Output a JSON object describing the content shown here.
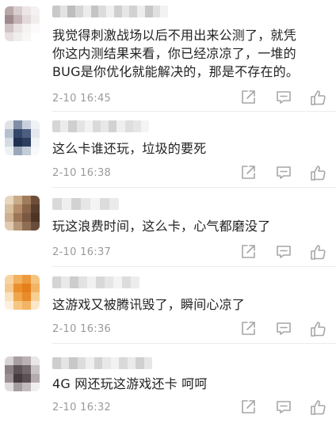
{
  "comments": [
    {
      "text_lines": [
        "我觉得刺激战场以后不用出来公测了，就凭",
        "你这内测结果来看，你已经凉凉了，一堆的",
        "BUG是你优化就能解决的，那是不存在的。"
      ],
      "time": "2-10 16:45",
      "avatar_colors": [
        "#b9a8a8",
        "#d8cdcd",
        "#ece6e6",
        "#f4f1f1",
        "#9e8a8c",
        "#c4b3b5",
        "#e2d9da",
        "#f1eded",
        "#d0c3c5",
        "#e9e1e2",
        "#f5f2f2",
        "#fbf9f9",
        "#e7dfe0",
        "#f2eded",
        "#f8f6f6",
        "#ffffff"
      ],
      "name_colors": [
        "#c9c9c9",
        "#e3e3e3",
        "#bdbdbd",
        "#d6d6d6",
        "#ececec",
        "#c4c4c4",
        "#dcdcdc",
        "#f0f0f0",
        "#cfcfcf",
        "#e6e6e6",
        "#d2d2d2",
        "#eeeeee",
        "#c7c7c7",
        "#e0e0e0",
        "#f2f2f2"
      ]
    },
    {
      "text_lines": [
        "这么卡谁还玩，垃圾的要死"
      ],
      "time": "2-10 16:38",
      "avatar_colors": [
        "#dfe3e8",
        "#7f8fa8",
        "#c9d0db",
        "#eef1f5",
        "#b6c1cf",
        "#34476a",
        "#4d5f80",
        "#e4e8ee",
        "#d5dbe4",
        "#1f3050",
        "#2c3d5e",
        "#f1f3f6",
        "#eef1f4",
        "#9aa7ba",
        "#c3ccd8",
        "#f7f8fa"
      ],
      "name_colors": [
        "#d6d6d6",
        "#ebebeb",
        "#cfcfcf",
        "#e4e4e4",
        "#f2f2f2",
        "#dadada",
        "#e8e8e8",
        "#d2d2d2",
        "#efefef",
        "#dedede",
        "#e6e6e6",
        "#f4f4f4"
      ]
    },
    {
      "text_lines": [
        "玩这浪费时间，这么卡，心气都磨没了"
      ],
      "time": "2-10 16:37",
      "avatar_colors": [
        "#e8d6bf",
        "#c9ab8a",
        "#a07c5d",
        "#6f4e39",
        "#d8c0a1",
        "#b48e6c",
        "#8a6548",
        "#5a3e2d",
        "#cdb08f",
        "#9c7657",
        "#7a5843",
        "#4d3425",
        "#e0cbb0",
        "#b8987a",
        "#8f6d54",
        "#6a4c3a"
      ],
      "name_colors": [
        "#d9d9d9",
        "#efefef",
        "#d2d2d2",
        "#e6e6e6",
        "#f4f4f4",
        "#dcdcdc",
        "#eaeaea"
      ]
    },
    {
      "text_lines": [
        "这游戏又被腾讯毁了，瞬间心凉了"
      ],
      "time": "2-10 16:36",
      "avatar_colors": [
        "#f7d3a2",
        "#f1b15f",
        "#ec9a3c",
        "#f4c582",
        "#f5c98e",
        "#eb8f2d",
        "#e47f1c",
        "#f2b465",
        "#f9e1bf",
        "#f0a64a",
        "#e98b2b",
        "#f6cf95",
        "#fcefdc",
        "#f6c682",
        "#f3b463",
        "#fbe6c8"
      ],
      "name_colors": [
        "#d4d4d4",
        "#e9e9e9",
        "#cdcdcd",
        "#e2e2e2",
        "#f1f1f1",
        "#d8d8d8",
        "#e6e6e6",
        "#f3f3f3",
        "#dddddd",
        "#ececec"
      ]
    },
    {
      "text_lines": [
        "4G 网还玩这游戏还卡  呵呵"
      ],
      "time": "2-10 16:32",
      "avatar_colors": [
        "#d8d3d4",
        "#a89fa3",
        "#b9b1b4",
        "#e9e6e7",
        "#8c8286",
        "#5e5357",
        "#73686c",
        "#c9c3c5",
        "#9a9094",
        "#463c40",
        "#5b5054",
        "#b3abae",
        "#e1dddf",
        "#a69da1",
        "#c2bbbe",
        "#f0eeef"
      ],
      "name_colors": [
        "#cecece",
        "#e4e4e4",
        "#c8c8c8",
        "#dddddd",
        "#efefef",
        "#d3d3d3",
        "#e8e8e8",
        "#f2f2f2",
        "#d9d9d9",
        "#eaeaea",
        "#d0d0d0",
        "#e6e6e6"
      ]
    }
  ],
  "actions": [
    {
      "name": "share-icon",
      "color": "#a6a6a6"
    },
    {
      "name": "comment-icon",
      "color": "#a6a6a6"
    },
    {
      "name": "like-icon",
      "color": "#a6a6a6"
    }
  ]
}
